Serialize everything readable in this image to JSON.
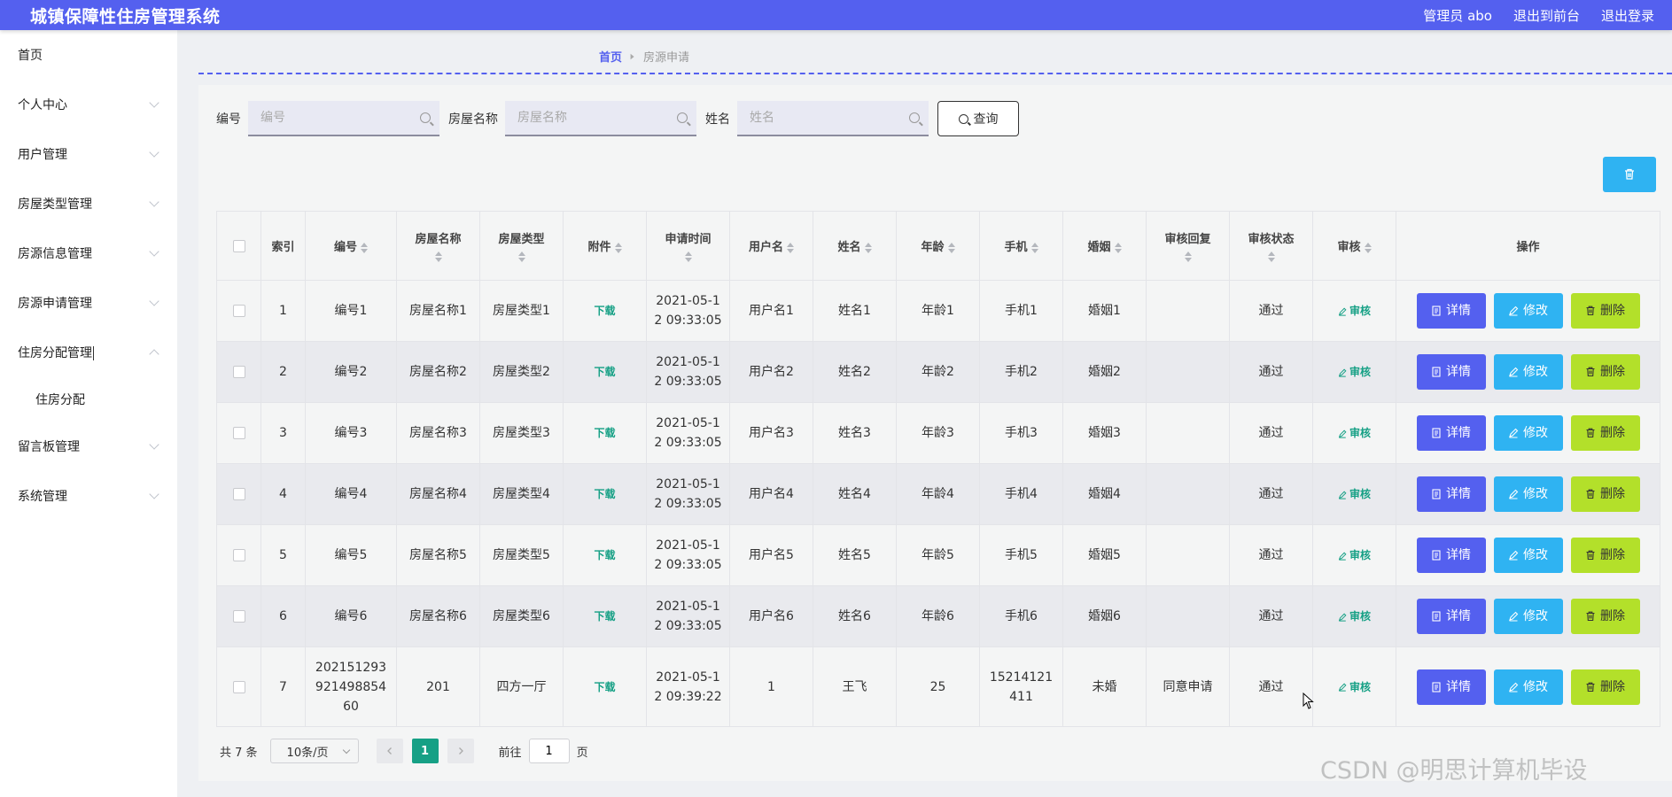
{
  "header": {
    "title": "城镇保障性住房管理系统",
    "admin": "管理员 abo",
    "to_front": "退出到前台",
    "logout": "退出登录"
  },
  "sidebar": {
    "items": [
      {
        "label": "首页"
      },
      {
        "label": "个人中心"
      },
      {
        "label": "用户管理"
      },
      {
        "label": "房屋类型管理"
      },
      {
        "label": "房源信息管理"
      },
      {
        "label": "房源申请管理"
      },
      {
        "label": "住房分配管理"
      },
      {
        "label": "住房分配"
      },
      {
        "label": "留言板管理"
      },
      {
        "label": "系统管理"
      }
    ]
  },
  "breadcrumb": {
    "home": "首页",
    "current": "房源申请"
  },
  "search": {
    "bianhao_label": "编号",
    "bianhao_placeholder": "编号",
    "fangwu_label": "房屋名称",
    "fangwu_placeholder": "房屋名称",
    "xingming_label": "姓名",
    "xingming_placeholder": "姓名",
    "query_label": "查询"
  },
  "table": {
    "headers": {
      "index": "索引",
      "bianhao": "编号",
      "fangwumingcheng": "房屋名称",
      "fangwuleixing": "房屋类型",
      "fujian": "附件",
      "shenqingshijian": "申请时间",
      "yonghuming": "用户名",
      "xingming": "姓名",
      "nianling": "年龄",
      "shouji": "手机",
      "hunyin": "婚姻",
      "shenhehuifu": "审核回复",
      "shenhezhuangtai": "审核状态",
      "shenhe": "审核",
      "caozuo": "操作"
    },
    "download_label": "下载",
    "audit_label": "审核",
    "detail_label": "详情",
    "edit_label": "修改",
    "delete_label": "删除",
    "rows": [
      {
        "index": "1",
        "bianhao": "编号1",
        "fangwumingcheng": "房屋名称1",
        "fangwuleixing": "房屋类型1",
        "shijian_l1": "2021-05-1",
        "shijian_l2": "2 09:33:05",
        "yonghuming": "用户名1",
        "xingming": "姓名1",
        "nianling": "年龄1",
        "shouji": "手机1",
        "hunyin": "婚姻1",
        "huifu": "",
        "zhuangtai": "通过"
      },
      {
        "index": "2",
        "bianhao": "编号2",
        "fangwumingcheng": "房屋名称2",
        "fangwuleixing": "房屋类型2",
        "shijian_l1": "2021-05-1",
        "shijian_l2": "2 09:33:05",
        "yonghuming": "用户名2",
        "xingming": "姓名2",
        "nianling": "年龄2",
        "shouji": "手机2",
        "hunyin": "婚姻2",
        "huifu": "",
        "zhuangtai": "通过"
      },
      {
        "index": "3",
        "bianhao": "编号3",
        "fangwumingcheng": "房屋名称3",
        "fangwuleixing": "房屋类型3",
        "shijian_l1": "2021-05-1",
        "shijian_l2": "2 09:33:05",
        "yonghuming": "用户名3",
        "xingming": "姓名3",
        "nianling": "年龄3",
        "shouji": "手机3",
        "hunyin": "婚姻3",
        "huifu": "",
        "zhuangtai": "通过"
      },
      {
        "index": "4",
        "bianhao": "编号4",
        "fangwumingcheng": "房屋名称4",
        "fangwuleixing": "房屋类型4",
        "shijian_l1": "2021-05-1",
        "shijian_l2": "2 09:33:05",
        "yonghuming": "用户名4",
        "xingming": "姓名4",
        "nianling": "年龄4",
        "shouji": "手机4",
        "hunyin": "婚姻4",
        "huifu": "",
        "zhuangtai": "通过"
      },
      {
        "index": "5",
        "bianhao": "编号5",
        "fangwumingcheng": "房屋名称5",
        "fangwuleixing": "房屋类型5",
        "shijian_l1": "2021-05-1",
        "shijian_l2": "2 09:33:05",
        "yonghuming": "用户名5",
        "xingming": "姓名5",
        "nianling": "年龄5",
        "shouji": "手机5",
        "hunyin": "婚姻5",
        "huifu": "",
        "zhuangtai": "通过"
      },
      {
        "index": "6",
        "bianhao": "编号6",
        "fangwumingcheng": "房屋名称6",
        "fangwuleixing": "房屋类型6",
        "shijian_l1": "2021-05-1",
        "shijian_l2": "2 09:33:05",
        "yonghuming": "用户名6",
        "xingming": "姓名6",
        "nianling": "年龄6",
        "shouji": "手机6",
        "hunyin": "婚姻6",
        "huifu": "",
        "zhuangtai": "通过"
      },
      {
        "index": "7",
        "bianhao_l1": "202151293",
        "bianhao_l2": "921498854",
        "bianhao_l3": "60",
        "fangwumingcheng": "201",
        "fangwuleixing": "四方一厅",
        "shijian_l1": "2021-05-1",
        "shijian_l2": "2 09:39:22",
        "yonghuming": "1",
        "xingming": "王飞",
        "nianling": "25",
        "shouji_l1": "15214121",
        "shouji_l2": "411",
        "hunyin": "未婚",
        "huifu": "同意申请",
        "zhuangtai": "通过"
      }
    ]
  },
  "pager": {
    "total": "共 7 条",
    "page_size": "10条/页",
    "current_page": "1",
    "goto_prefix": "前往",
    "goto_value": "1",
    "goto_suffix": "页"
  },
  "watermark": "CSDN @明思计算机毕设",
  "colors": {
    "topbar": "#5460ef",
    "detail_button": "#5460ef",
    "edit_button": "#2fb3f2",
    "delete_button": "#b3e02a",
    "accent_green": "#16a085"
  }
}
